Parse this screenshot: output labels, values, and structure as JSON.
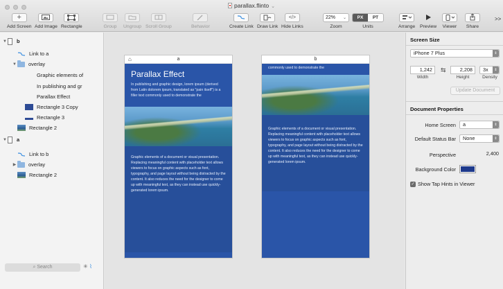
{
  "window": {
    "title": "parallax.flinto"
  },
  "toolbar": {
    "add_screen": "Add Screen",
    "add_image": "Add Image",
    "rectangle": "Rectangle",
    "group": "Group",
    "ungroup": "Ungroup",
    "scroll_group": "Scroll Group",
    "behavior": "Behavior",
    "create_link": "Create Link",
    "draw_link": "Draw Link",
    "hide_links": "Hide Links",
    "zoom_value": "22%",
    "zoom_label": "Zoom",
    "units_px": "PX",
    "units_pt": "PT",
    "units_label": "Units",
    "arrange": "Arrange",
    "preview": "Preview",
    "viewer": "Viewer",
    "share": "Share",
    "overflow": ">>"
  },
  "layers": {
    "screen_b": "b",
    "link_to_a": "Link to a",
    "overlay": "overlay",
    "graphic_elements": "Graphic elements of",
    "in_publishing": "In publishing and gr",
    "parallax_effect": "Parallax Effect",
    "rect3copy": "Rectangle 3 Copy",
    "rect3": "Rectangle 3",
    "rect2": "Rectangle 2",
    "screen_a": "a",
    "link_to_b": "Link to b",
    "overlay2": "overlay",
    "rect2b": "Rectangle 2"
  },
  "search": {
    "placeholder": "Search"
  },
  "canvas": {
    "screen_a_name": "a",
    "screen_b_name": "b",
    "heading": "Parallax Effect",
    "para1": "In publishing and graphic design, lorem ipsum (derived from Latin dolorem ipsum, translated as \"pain itself\") is a filler text commonly used to demonstrate the",
    "para2": "Graphic elements of a document or visual presentation. Replacing meaningful content with placeholder text allows viewers to focus on graphic aspects such as font, typography, and page layout without being distracted by the content. It also reduces the need for the designer to come up with meaningful text, as they can instead use quickly-generated lorem ipsum.",
    "b_top": "commonly used to demonstrate the"
  },
  "panel": {
    "screen_size_title": "Screen Size",
    "device": "iPhone 7 Plus",
    "width": "1,242",
    "height": "2,208",
    "density": "3x",
    "width_label": "Width",
    "height_label": "Height",
    "density_label": "Density",
    "update_button": "Update Document",
    "doc_props_title": "Document Properties",
    "home_screen_label": "Home Screen",
    "home_screen_value": "a",
    "status_bar_label": "Default Status Bar",
    "status_bar_value": "None",
    "perspective_label": "Perspective",
    "perspective_value": "2,400",
    "bg_color_label": "Background Color",
    "bg_color": "#1e3a8c",
    "tap_hints_label": "Show Tap Hints in Viewer"
  }
}
